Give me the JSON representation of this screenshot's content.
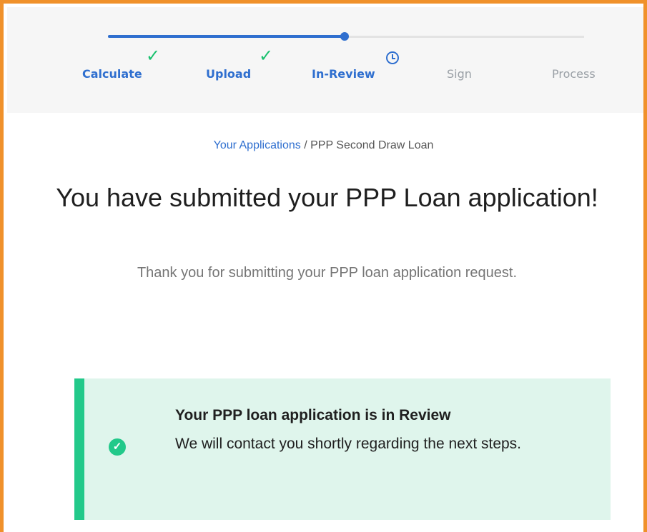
{
  "stepper": {
    "steps": [
      {
        "label": "Calculate",
        "status": "complete"
      },
      {
        "label": "Upload",
        "status": "complete"
      },
      {
        "label": "In-Review",
        "status": "current"
      },
      {
        "label": "Sign",
        "status": "pending"
      },
      {
        "label": "Process",
        "status": "pending"
      }
    ],
    "check_glyph": "✓"
  },
  "breadcrumb": {
    "link": "Your Applications",
    "separator": " / ",
    "current": "PPP Second Draw Loan"
  },
  "page": {
    "title": "You have submitted your PPP Loan application!",
    "subtitle": "Thank you for submitting your PPP loan application request."
  },
  "alert": {
    "title": "Your PPP loan application is in Review",
    "body": "We will contact you shortly regarding the next steps.",
    "icon_glyph": "✓"
  },
  "colors": {
    "frame": "#f0912b",
    "primary": "#2f6fcf",
    "check": "#19c16e",
    "alert_bg": "#dff5ec",
    "alert_accent": "#22c98a"
  }
}
